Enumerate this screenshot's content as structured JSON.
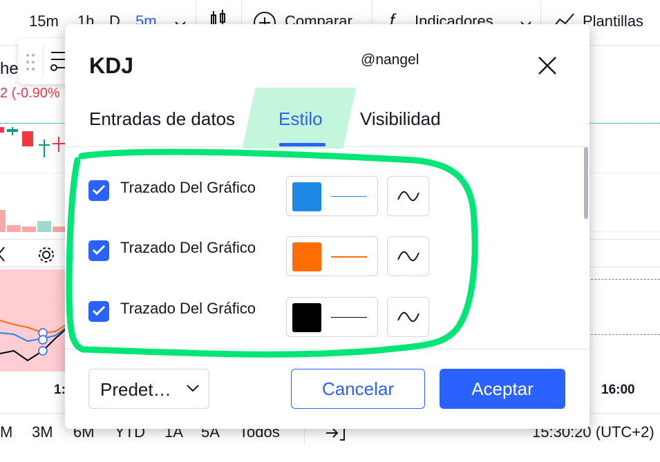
{
  "topbar": {
    "timeframes": [
      "15m",
      "1h",
      "D",
      "5m"
    ],
    "compare_label": "Comparar",
    "indicators_label": "Indicadores",
    "templates_label": "Plantillas"
  },
  "symbol": {
    "name_fragment": "he",
    "change_fragment": "2 (-0.90%"
  },
  "timeaxis": {
    "left_label": "1:",
    "right_label": "16:00"
  },
  "bottombar": {
    "ranges": [
      "M",
      "3M",
      "6M",
      "YTD",
      "1A",
      "5A",
      "Todos"
    ],
    "clock": "15:30:20 (UTC+2)"
  },
  "modal": {
    "title": "KDJ",
    "watermark": "@nangel",
    "tabs": [
      {
        "label": "Entradas de datos",
        "active": false
      },
      {
        "label": "Estilo",
        "active": true
      },
      {
        "label": "Visibilidad",
        "active": false
      }
    ],
    "rows": [
      {
        "label": "Trazado Del Gráfico",
        "checked": true,
        "color": "#1e88e5"
      },
      {
        "label": "Trazado Del Gráfico",
        "checked": true,
        "color": "#ff6d00"
      },
      {
        "label": "Trazado Del Gráfico",
        "checked": true,
        "color": "#000000"
      }
    ],
    "preset_label": "Predet…",
    "cancel_label": "Cancelar",
    "accept_label": "Aceptar"
  },
  "colors": {
    "accent": "#2962ff",
    "annotation": "#00e676",
    "negative": "#f23645"
  }
}
